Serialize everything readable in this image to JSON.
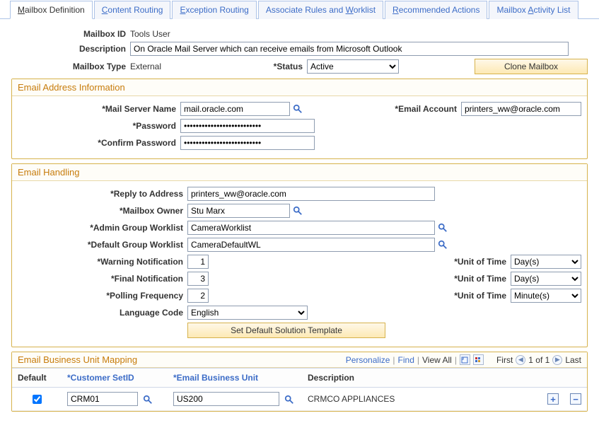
{
  "tabs": [
    {
      "pre": "",
      "accel": "M",
      "post": "ailbox Definition"
    },
    {
      "pre": "",
      "accel": "C",
      "post": "ontent Routing"
    },
    {
      "pre": "",
      "accel": "E",
      "post": "xception Routing"
    },
    {
      "pre": "Associate Rules and ",
      "accel": "W",
      "post": "orklist"
    },
    {
      "pre": "",
      "accel": "R",
      "post": "ecommended Actions"
    },
    {
      "pre": "Mailbox ",
      "accel": "A",
      "post": "ctivity List"
    }
  ],
  "header": {
    "mailbox_id_label": "Mailbox ID",
    "mailbox_id_value": "Tools User",
    "description_label": "Description",
    "description_value": "On Oracle Mail Server which can receive emails from Microsoft Outlook",
    "mailbox_type_label": "Mailbox Type",
    "mailbox_type_value": "External",
    "status_label": "*Status",
    "status_value": "Active",
    "clone_btn": "Clone Mailbox"
  },
  "section_email_addr": {
    "title": "Email Address Information",
    "mail_server_label": "*Mail Server Name",
    "mail_server_value": "mail.oracle.com",
    "email_account_label": "*Email Account",
    "email_account_value": "printers_ww@oracle.com",
    "password_label": "*Password",
    "password_value": "••••••••••••••••••••••••••",
    "confirm_label": "*Confirm Password",
    "confirm_value": "••••••••••••••••••••••••••"
  },
  "section_email_handling": {
    "title": "Email Handling",
    "reply_label": "*Reply to Address",
    "reply_value": "printers_ww@oracle.com",
    "owner_label": "*Mailbox Owner",
    "owner_value": "Stu Marx",
    "admin_wl_label": "*Admin Group Worklist",
    "admin_wl_value": "CameraWorklist",
    "default_wl_label": "*Default Group Worklist",
    "default_wl_value": "CameraDefaultWL",
    "warn_label": "*Warning Notification",
    "warn_value": "1",
    "final_label": "*Final Notification",
    "final_value": "3",
    "poll_label": "*Polling Frequency",
    "poll_value": "2",
    "lang_label": "Language Code",
    "lang_value": "English",
    "uot_label": "*Unit of Time",
    "uot1": "Day(s)",
    "uot2": "Day(s)",
    "uot3": "Minute(s)",
    "set_default_btn": "Set Default Solution Template"
  },
  "grid": {
    "title": "Email Business Unit Mapping",
    "personalize": "Personalize",
    "find": "Find",
    "view_all": "View All",
    "first": "First",
    "pager": "1 of 1",
    "last": "Last",
    "col_default": "Default",
    "col_setid": "*Customer SetID",
    "col_bu": "*Email Business Unit",
    "col_desc": "Description",
    "rows": [
      {
        "default": true,
        "setid": "CRM01",
        "bu": "US200",
        "desc": "CRMCO APPLIANCES"
      }
    ]
  }
}
